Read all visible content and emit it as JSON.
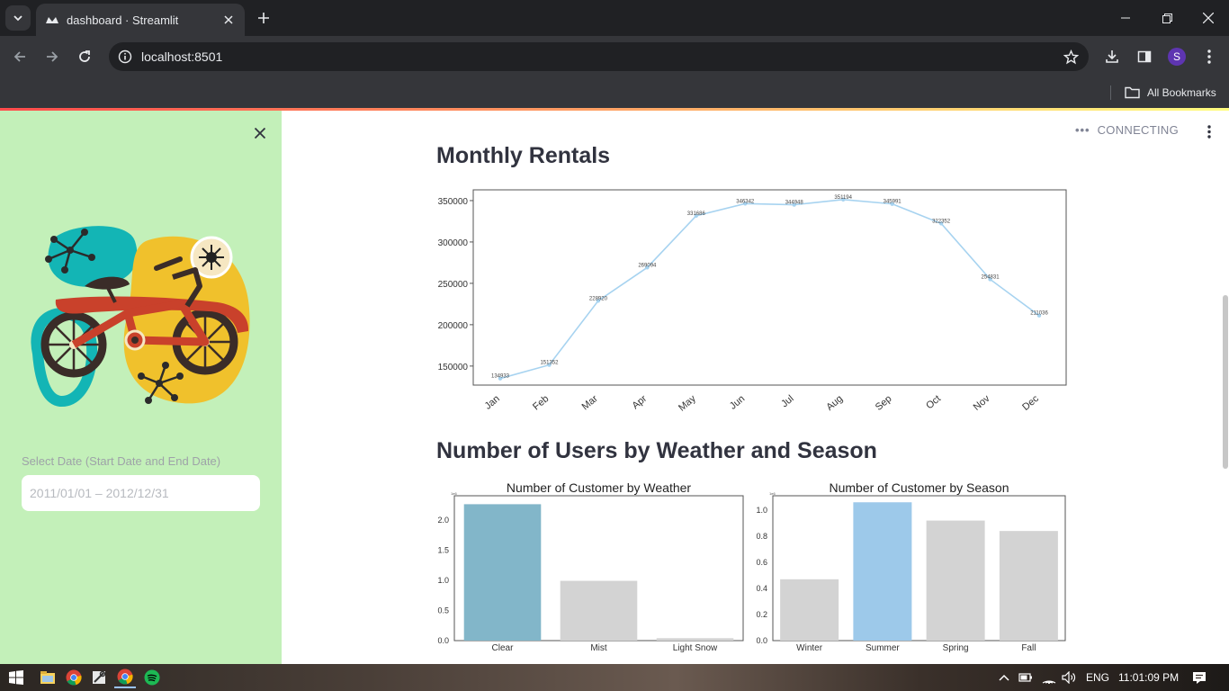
{
  "browser": {
    "tab_title": "dashboard · Streamlit",
    "url": "localhost:8501",
    "bookmarks_label": "All Bookmarks",
    "profile_initial": "S"
  },
  "app": {
    "status": "CONNECTING"
  },
  "sidebar": {
    "date_label": "Select Date (Start Date and End Date)",
    "date_value": "2011/01/01 – 2012/12/31"
  },
  "main": {
    "monthly_title": "Monthly Rentals",
    "users_title": "Number of Users by Weather and Season"
  },
  "taskbar": {
    "language": "ENG",
    "time": "11:01:09 PM"
  },
  "chart_data": [
    {
      "type": "line",
      "categories": [
        "Jan",
        "Feb",
        "Mar",
        "Apr",
        "May",
        "Jun",
        "Jul",
        "Aug",
        "Sep",
        "Oct",
        "Nov",
        "Dec"
      ],
      "values": [
        134933,
        151352,
        228920,
        269094,
        331686,
        346342,
        344948,
        351194,
        345991,
        322352,
        254831,
        211036
      ],
      "value_labels": [
        "134933",
        "151352",
        "228920",
        "269094",
        "331686",
        "346342",
        "344948",
        "351194",
        "345991",
        "322352",
        "254831",
        "211036"
      ],
      "yticks": [
        150000,
        200000,
        250000,
        300000,
        350000
      ],
      "ytick_labels": [
        "150000",
        "200000",
        "250000",
        "300000",
        "350000"
      ],
      "ylim": [
        127000,
        363000
      ],
      "color": "#a7d3f0",
      "title": "",
      "xlabel": "",
      "ylabel": "",
      "grid": false
    },
    {
      "type": "bar",
      "title": "Number of Customer by Weather",
      "categories": [
        "Clear",
        "Mist",
        "Light Snow"
      ],
      "values": [
        2.26,
        0.99,
        0.04
      ],
      "scale_label": "1e6",
      "yticks": [
        0.0,
        0.5,
        1.0,
        1.5,
        2.0
      ],
      "ytick_labels": [
        "0.0",
        "0.5",
        "1.0",
        "1.5",
        "2.0"
      ],
      "ylim": [
        0,
        2.4
      ],
      "colors": [
        "#82b6c9",
        "#d3d3d3",
        "#d3d3d3"
      ]
    },
    {
      "type": "bar",
      "title": "Number of Customer by Season",
      "categories": [
        "Winter",
        "Summer",
        "Spring",
        "Fall"
      ],
      "values": [
        0.47,
        1.06,
        0.92,
        0.84
      ],
      "scale_label": "1e6",
      "yticks": [
        0.0,
        0.2,
        0.4,
        0.6,
        0.8,
        1.0
      ],
      "ytick_labels": [
        "0.0",
        "0.2",
        "0.4",
        "0.6",
        "0.8",
        "1.0"
      ],
      "ylim": [
        0,
        1.11
      ],
      "colors": [
        "#d3d3d3",
        "#9dc9ea",
        "#d3d3d3",
        "#d3d3d3"
      ]
    }
  ]
}
